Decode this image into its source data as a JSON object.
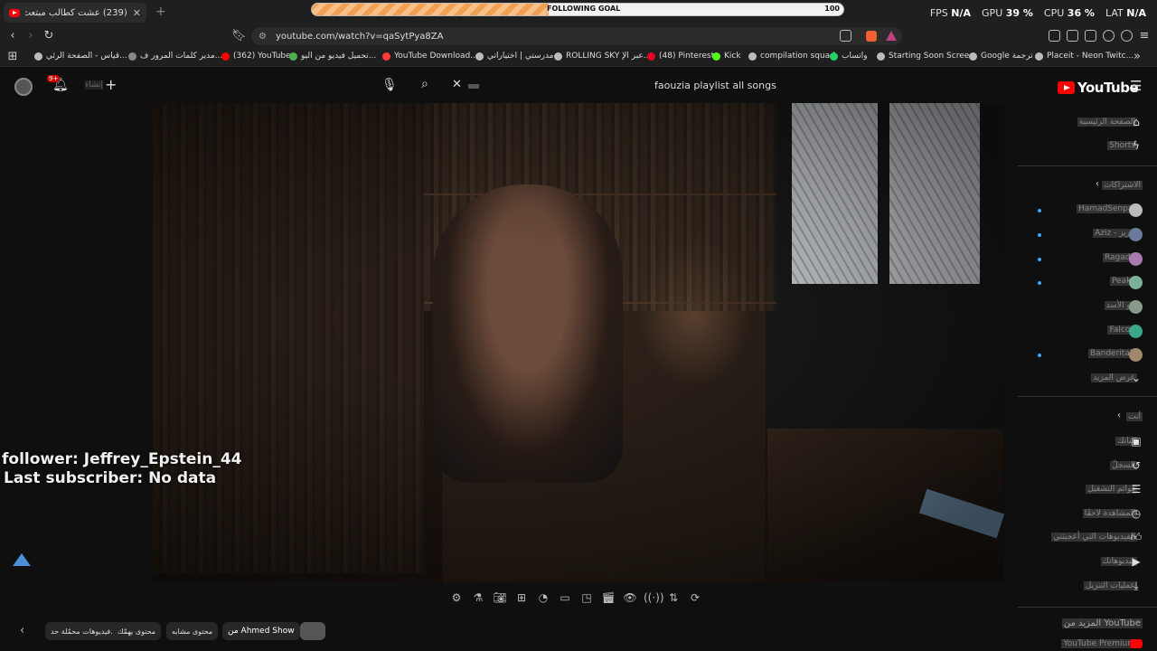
{
  "browser": {
    "tab_title": "(239) عشت كطالب مبتعث في بر...",
    "goal_label": "FOLLOWING GOAL",
    "goal_number": "100",
    "goal_progress": 0.445,
    "stats": {
      "fps_label": "FPS",
      "fps": "N/A",
      "gpu_label": "GPU",
      "gpu": "39 %",
      "cpu_label": "CPU",
      "cpu": "36 %",
      "lat_label": "LAT",
      "lat": "N/A"
    },
    "url": "youtube.com/watch?v=qaSytPya8ZA"
  },
  "bookmarks": [
    {
      "label": "قياس - الصفحة الرئي...",
      "color": "#bbb"
    },
    {
      "label": "مدير كلمات المرور ف...",
      "color": "#888"
    },
    {
      "label": "(362) YouTube",
      "color": "#ff0000"
    },
    {
      "label": "تحميل فيديو من اليو...",
      "color": "#4caf50"
    },
    {
      "label": "YouTube Download...",
      "color": "#ff3b3b"
    },
    {
      "label": "مدرستي | اختياراتي",
      "color": "#bbb"
    },
    {
      "label": "ROLLING SKY عبر الإ...",
      "color": "#bbb"
    },
    {
      "label": "(48) Pinterest",
      "color": "#e60023"
    },
    {
      "label": "Kick",
      "color": "#53fc18"
    },
    {
      "label": "compilation squad",
      "color": "#bbb"
    },
    {
      "label": "واتساب",
      "color": "#25d366"
    },
    {
      "label": "Starting Soon Scree...",
      "color": "#bbb"
    },
    {
      "label": "Google ترجمة",
      "color": "#bbb"
    },
    {
      "label": "Placeit - Neon Twitc...",
      "color": "#bbb"
    }
  ],
  "youtube": {
    "search_query": "faouzia playlist all songs",
    "create_label": "إنشاء",
    "notif_count": "9+",
    "logo_text": "YouTube"
  },
  "overlay": {
    "follower": "follower: Jeffrey_Epstein_44",
    "subscriber": "Last subscriber: No data"
  },
  "chips": {
    "from": "من Ahmed Show",
    "related": "محتوى مشابه",
    "for_you": "محتوى يهمّك",
    "uploaded": "فيديوهات محمّلة حد..."
  },
  "sidebar": {
    "home": "الصفحة الرئيسية",
    "shorts": "Shorts",
    "subscriptions": "الاشتراكات",
    "channels": [
      "HamadSenpai",
      "Aziz - عزيز",
      "Ragada",
      "Peaks",
      "ابو الأسد",
      "Falcon",
      "BanderitaX"
    ],
    "show_more": "عرض المزيد",
    "you": "أنت",
    "your_channel": "قناتك",
    "history": "السجلّ",
    "playlists": "قوائم التشغيل",
    "watch_later": "المشاهدة لاحقًا",
    "liked": "الفيديوهات التي أعجبتني",
    "your_videos": "فيديوهاتك",
    "downloads": "عمليات التنزيل",
    "more_from": "المزيد من YouTube",
    "premium": "YouTube Premium"
  }
}
